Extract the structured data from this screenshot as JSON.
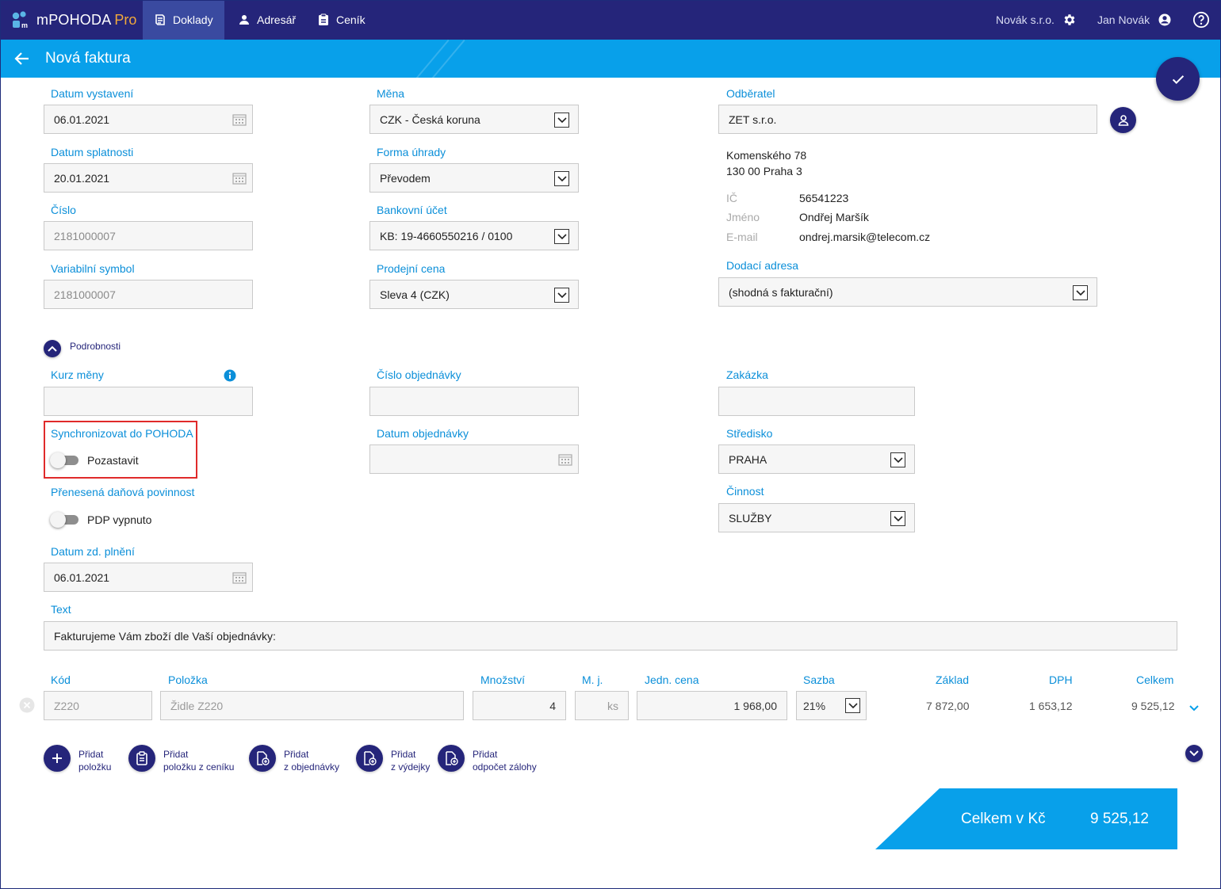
{
  "app": {
    "logo_name": "mPOHODA",
    "logo_suffix": "Pro"
  },
  "nav": {
    "tabs": [
      {
        "label": "Doklady",
        "icon": "documents-icon",
        "active": true
      },
      {
        "label": "Adresář",
        "icon": "person-icon",
        "active": false
      },
      {
        "label": "Ceník",
        "icon": "pricelist-icon",
        "active": false
      }
    ],
    "company": "Novák s.r.o.",
    "user": "Jan Novák"
  },
  "header": {
    "title": "Nová faktura"
  },
  "colors": {
    "navbar": "#25257a",
    "accent": "#08a0ea",
    "label": "#0b8fd9",
    "highlight": "#e02a2a"
  },
  "form": {
    "datum_vystaveni": {
      "label": "Datum vystavení",
      "value": "06.01.2021"
    },
    "datum_splatnosti": {
      "label": "Datum splatnosti",
      "value": "20.01.2021"
    },
    "cislo": {
      "label": "Číslo",
      "value": "2181000007"
    },
    "variabilni_symbol": {
      "label": "Variabilní symbol",
      "value": "2181000007"
    },
    "mena": {
      "label": "Měna",
      "value": "CZK - Česká koruna"
    },
    "forma_uhrady": {
      "label": "Forma úhrady",
      "value": "Převodem"
    },
    "bankovni_ucet": {
      "label": "Bankovní účet",
      "value": "KB: 19-4660550216 / 0100"
    },
    "prodejni_cena": {
      "label": "Prodejní cena",
      "value": "Sleva 4 (CZK)"
    },
    "odberatel": {
      "label": "Odběratel",
      "value": "ZET s.r.o.",
      "street": "Komenského 78",
      "city": "130 00 Praha 3",
      "ic_label": "IČ",
      "ic": "56541223",
      "jmeno_label": "Jméno",
      "jmeno": "Ondřej Maršík",
      "email_label": "E-mail",
      "email": "ondrej.marsik@telecom.cz"
    },
    "dodaci_adresa": {
      "label": "Dodací adresa",
      "value": "(shodná s fakturační)"
    },
    "podrobnosti_label": "Podrobnosti",
    "kurz_meny": {
      "label": "Kurz měny",
      "value": ""
    },
    "cislo_objednavky": {
      "label": "Číslo objednávky",
      "value": ""
    },
    "zakazka": {
      "label": "Zakázka",
      "value": ""
    },
    "synchronizovat": {
      "label": "Synchronizovat do POHODA",
      "toggle_label": "Pozastavit",
      "on": false
    },
    "datum_objednavky": {
      "label": "Datum objednávky",
      "value": ""
    },
    "stredisko": {
      "label": "Středisko",
      "value": "PRAHA"
    },
    "prenesena": {
      "label": "Přenesená daňová povinnost",
      "toggle_label": "PDP vypnuto",
      "on": false
    },
    "cinnost": {
      "label": "Činnost",
      "value": "SLUŽBY"
    },
    "datum_zd_plneni": {
      "label": "Datum zd. plnění",
      "value": "06.01.2021"
    },
    "text": {
      "label": "Text",
      "value": "Fakturujeme Vám zboží dle Vaší objednávky:"
    }
  },
  "items": {
    "headers": {
      "kod": "Kód",
      "polozka": "Položka",
      "mnozstvi": "Množství",
      "mj": "M. j.",
      "jedn_cena": "Jedn. cena",
      "sazba": "Sazba",
      "zaklad": "Základ",
      "dph": "DPH",
      "celkem": "Celkem"
    },
    "rows": [
      {
        "kod": "Z220",
        "polozka": "Židle Z220",
        "mnozstvi": "4",
        "mj": "ks",
        "jedn_cena": "1 968,00",
        "sazba": "21%",
        "zaklad": "7 872,00",
        "dph": "1 653,12",
        "celkem": "9 525,12"
      }
    ]
  },
  "actions": [
    {
      "line1": "Přidat",
      "line2": "položku",
      "icon": "plus-icon"
    },
    {
      "line1": "Přidat",
      "line2": "položku z ceníku",
      "icon": "clipboard-icon"
    },
    {
      "line1": "Přidat",
      "line2": "z objednávky",
      "icon": "document-add-icon"
    },
    {
      "line1": "Přidat",
      "line2": "z výdejky",
      "icon": "document-add-icon"
    },
    {
      "line1": "Přidat",
      "line2": "odpočet zálohy",
      "icon": "document-add-icon"
    }
  ],
  "total": {
    "label": "Celkem v Kč",
    "value": "9 525,12"
  }
}
